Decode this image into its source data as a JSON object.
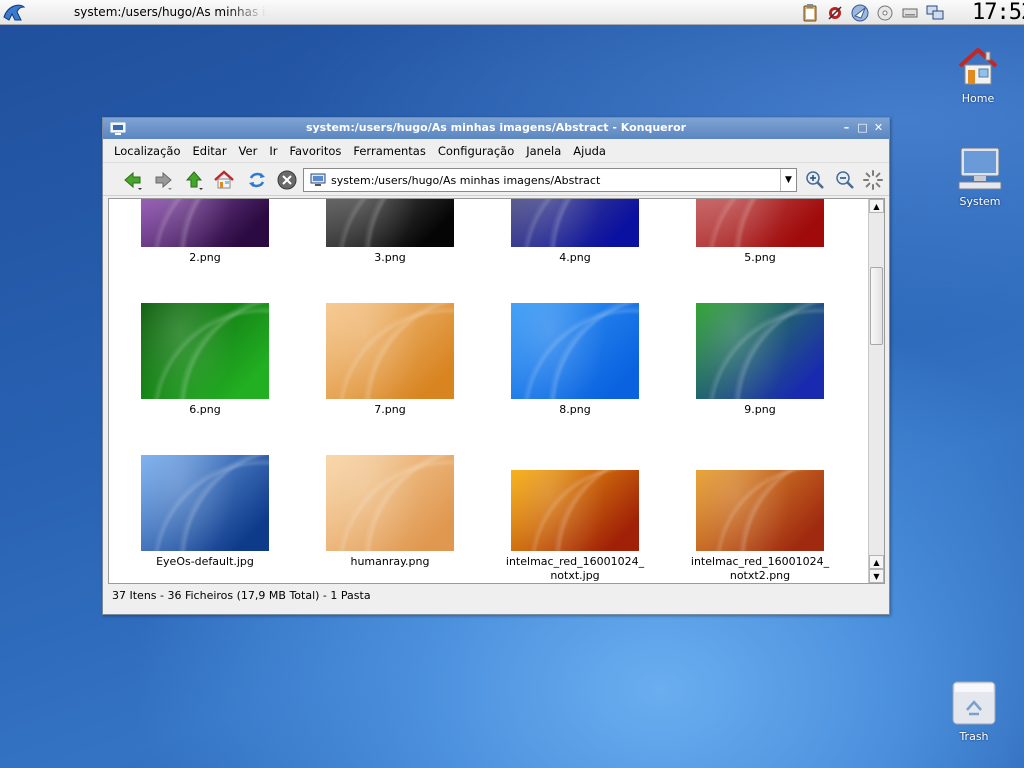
{
  "panel": {
    "task_title": "system:/users/hugo/As minhas imagens/Abstract - Konqueror",
    "clock": "17:52",
    "tray_icons": [
      "klipper-icon",
      "mail-icon",
      "korganizer-icon",
      "cd-icon",
      "removable-drive-icon",
      "network-icon"
    ]
  },
  "desktop": {
    "icons": [
      {
        "name": "home-icon",
        "label": "Home"
      },
      {
        "name": "system-icon",
        "label": "System"
      },
      {
        "name": "trash-icon",
        "label": "Trash"
      }
    ]
  },
  "window": {
    "title": "system:/users/hugo/As minhas imagens/Abstract - Konqueror",
    "menu": [
      "Localização",
      "Editar",
      "Ver",
      "Ir",
      "Favoritos",
      "Ferramentas",
      "Configuração",
      "Janela",
      "Ajuda"
    ],
    "url": "system:/users/hugo/As minhas imagens/Abstract",
    "status": "37 Itens - 36 Ficheiros (17,9 MB Total) - 1 Pasta",
    "files": [
      {
        "label": "2.png",
        "color_a": "#b470d8",
        "color_b": "#2a0a40"
      },
      {
        "label": "3.png",
        "color_a": "#7a7a7a",
        "color_b": "#050505"
      },
      {
        "label": "4.png",
        "color_a": "#6a6a80",
        "color_b": "#0a10a0"
      },
      {
        "label": "5.png",
        "color_a": "#d07a7a",
        "color_b": "#a00a0a"
      },
      {
        "label": "6.png",
        "color_a": "#0a5a0a",
        "color_b": "#22b022"
      },
      {
        "label": "7.png",
        "color_a": "#f6c890",
        "color_b": "#d88420"
      },
      {
        "label": "8.png",
        "color_a": "#3a9cf6",
        "color_b": "#0a62e0"
      },
      {
        "label": "9.png",
        "color_a": "#2aa02a",
        "color_b": "#1a2ab0"
      },
      {
        "label": "EyeOs-default.jpg",
        "color_a": "#7ab0f0",
        "color_b": "#0e3a8a"
      },
      {
        "label": "humanray.png",
        "color_a": "#f8d6a8",
        "color_b": "#e09850"
      },
      {
        "label": "intelmac_red_16001024_notxt.jpg",
        "color_a": "#f8b010",
        "color_b": "#a02008"
      },
      {
        "label": "intelmac_red_16001024_notxt2.png",
        "color_a": "#e8a030",
        "color_b": "#a02a10"
      }
    ]
  }
}
